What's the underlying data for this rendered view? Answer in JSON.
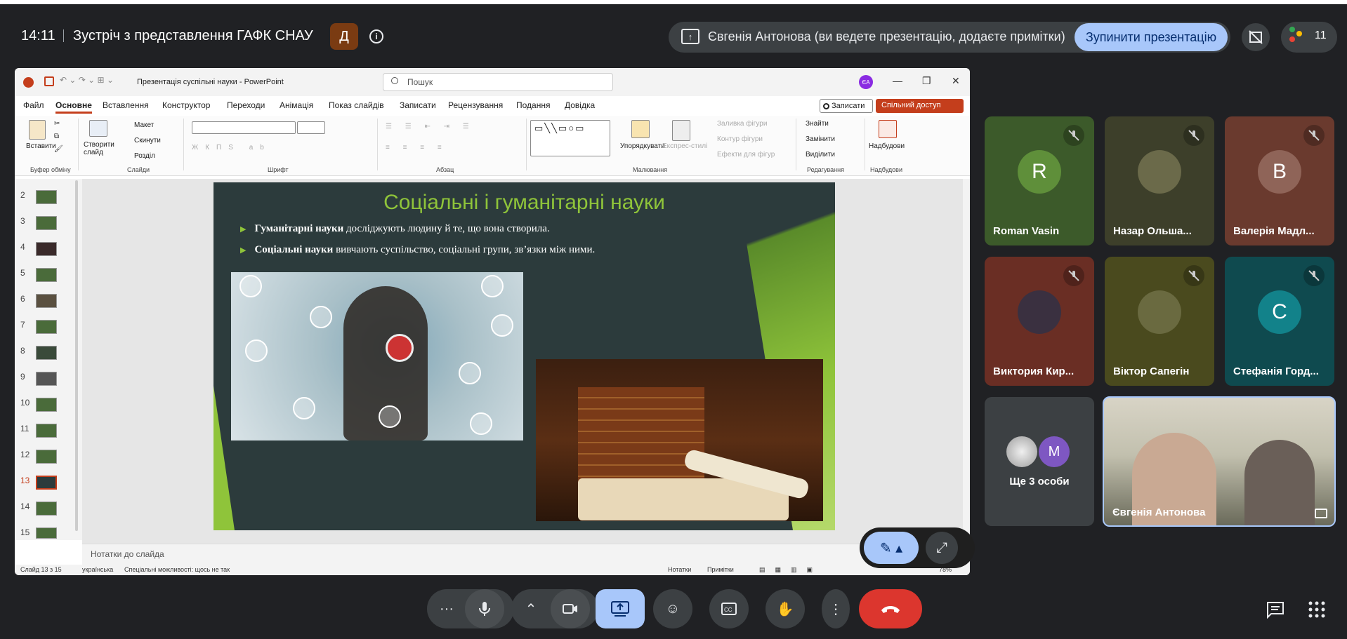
{
  "meeting": {
    "time": "14:11",
    "title": "Зустріч з представлення ГАФК СНАУ",
    "host_badge": "Д"
  },
  "presenting": {
    "text": "Євгенія Антонова (ви ведете презентацію, додаєте примітки)",
    "stop_label": "Зупинити презентацію",
    "people_count": "11"
  },
  "ppt": {
    "doc_title": "Презентація суспільні науки - PowerPoint",
    "search_placeholder": "Пошук",
    "avatar": "ЄА",
    "tabs": [
      "Файл",
      "Основне",
      "Вставлення",
      "Конструктор",
      "Переходи",
      "Анімація",
      "Показ слайдів",
      "Записати",
      "Рецензування",
      "Подання",
      "Довідка"
    ],
    "record_label": "Записати",
    "share_label": "Спільний доступ",
    "ribbon": {
      "paste": "Вставити",
      "new_slide": "Створити слайд",
      "layout": "Макет",
      "reset": "Скинути",
      "section": "Розділ",
      "arrange": "Упорядкувати",
      "quick_styles": "Експрес-стилі",
      "shape_fill": "Заливка фігури",
      "shape_outline": "Контур фігури",
      "shape_effects": "Ефекти для фігур",
      "find": "Знайти",
      "replace": "Замінити",
      "select": "Виділити",
      "addins": "Надбудови",
      "groups": {
        "clipboard": "Буфер обміну",
        "slides": "Слайди",
        "font": "Шрифт",
        "paragraph": "Абзац",
        "drawing": "Малювання",
        "editing": "Редагування",
        "addins": "Надбудови"
      }
    },
    "thumbs": [
      "2",
      "3",
      "4",
      "5",
      "6",
      "7",
      "8",
      "9",
      "10",
      "11",
      "12",
      "13",
      "14",
      "15"
    ],
    "current_slide": "13",
    "slide": {
      "title": "Соціальні і гуманітарні науки",
      "b1_bold": "Гуманітарні науки",
      "b1_rest": " досліджують людину й те, що вона створила.",
      "b2_bold": "Соціальні науки",
      "b2_rest": " вивчають суспільство, соціальні групи, зв’язки між ними."
    },
    "notes": "Нотатки до слайда",
    "status": {
      "slide": "Слайд 13 з 15",
      "lang": "українська",
      "access": "Спеціальні можливості: щось не так",
      "notes": "Нотатки",
      "comments": "Примітки",
      "zoom": "78%"
    }
  },
  "participants": [
    {
      "name": "Roman Vasin",
      "initial": "R",
      "bg": "#3c5a2a",
      "avatar": "#5f8f3a"
    },
    {
      "name": "Назар Ольша...",
      "initial": "",
      "bg": "#3d3f2a",
      "avatar": "#6b6a4a"
    },
    {
      "name": "Валерія Мадл...",
      "initial": "В",
      "bg": "#6a3a2e",
      "avatar": "#8f6458"
    },
    {
      "name": "Виктория Кир...",
      "initial": "",
      "bg": "#6a2e24",
      "avatar": "#3a3040"
    },
    {
      "name": "Віктор Сапегін",
      "initial": "",
      "bg": "#4a4a1e",
      "avatar": "#6a6a40"
    },
    {
      "name": "Стефанія Горд...",
      "initial": "С",
      "bg": "#0f4a4f",
      "avatar": "#12828a"
    }
  ],
  "more": {
    "text": "Ще 3 особи",
    "initial": "M"
  },
  "self": {
    "name": "Євгенія Антонова"
  }
}
